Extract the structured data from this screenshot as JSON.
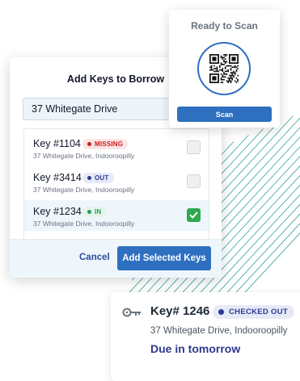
{
  "key_card": {
    "icon": "key-icon",
    "title": "Key# 1246",
    "status": "CHECKED OUT",
    "address": "37 Whitegate Drive, Indooroopilly",
    "due": "Due in tomorrow"
  },
  "modal": {
    "title": "Add Keys to Borrow",
    "search_value": "37 Whitegate Drive",
    "keys": [
      {
        "title": "Key #1104",
        "status": "MISSING",
        "address": "37 Whitegate Drive, Indooroopilly",
        "checked": false
      },
      {
        "title": "Key #3414",
        "status": "OUT",
        "address": "37 Whitegate Drive, Indooroopilly",
        "checked": false
      },
      {
        "title": "Key #1234",
        "status": "IN",
        "address": "37 Whitegate Drive, Indooroopilly",
        "checked": true
      }
    ],
    "cancel_label": "Cancel",
    "add_label": "Add Selected Keys"
  },
  "scan_card": {
    "title": "Ready to Scan",
    "icon": "qr-code-icon",
    "scan_label": "Scan"
  },
  "colors": {
    "accent": "#2e6fc0",
    "checked_badge": "#2b3b8f",
    "missing": "#c81e1e",
    "in": "#2b9a57",
    "stripes": "#2f9e8f"
  }
}
